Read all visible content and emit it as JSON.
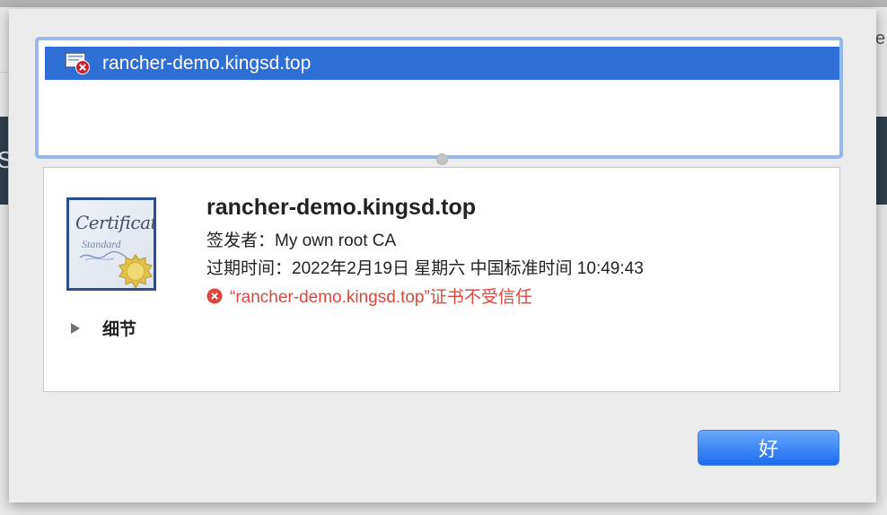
{
  "background": {
    "edge_letter_right": "e",
    "edge_letter_left": "S"
  },
  "cert_list": {
    "items": [
      {
        "label": "rancher-demo.kingsd.top",
        "icon": "certificate-error-icon",
        "selected": true
      }
    ]
  },
  "detail": {
    "cert_image": {
      "title": "Certificate",
      "subtitle": "Standard"
    },
    "name": "rancher-demo.kingsd.top",
    "issuer": "签发者：My own root CA",
    "expiry": "过期时间：2022年2月19日 星期六 中国标准时间 10:49:43",
    "trust_status": "“rancher-demo.kingsd.top”证书不受信任",
    "details_label": "细节"
  },
  "buttons": {
    "ok_label": "好"
  },
  "colors": {
    "selection": "#2f6fd5",
    "error": "#e0453a",
    "button": "#1c6cf2"
  }
}
